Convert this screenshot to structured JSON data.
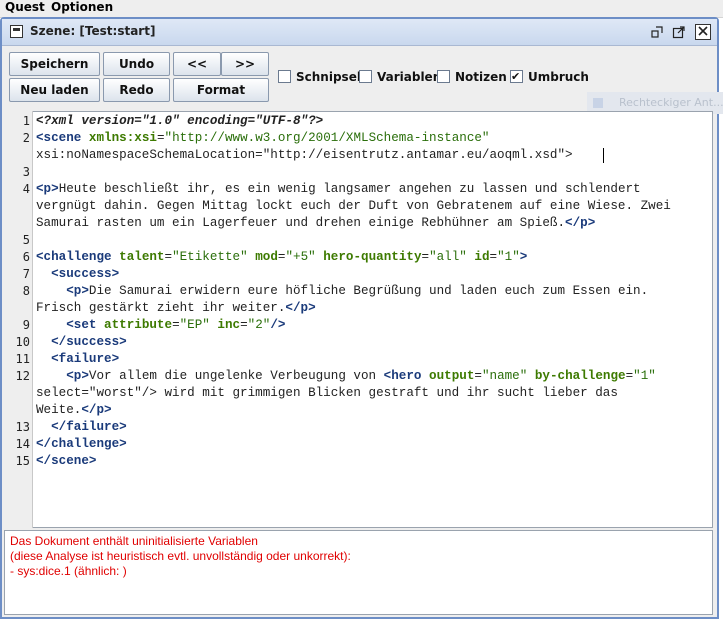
{
  "menubar": {
    "items": [
      "Quest",
      "Optionen"
    ]
  },
  "window": {
    "title": "Szene: [Test:start]",
    "controls": [
      "restore-icon",
      "maximize-icon",
      "close-icon"
    ]
  },
  "toolbar": {
    "save": "Speichern",
    "reload": "Neu laden",
    "undo": "Undo",
    "redo": "Redo",
    "prev": "<<",
    "next": ">>",
    "format": "Format",
    "checkboxes": [
      {
        "label": "Schnipsel",
        "checked": false
      },
      {
        "label": "Variablen",
        "checked": false
      },
      {
        "label": "Notizen",
        "checked": false
      },
      {
        "label": "Umbruch",
        "checked": true
      }
    ]
  },
  "faded_panel": {
    "text": "Rechteckiger Ant..."
  },
  "editor": {
    "line_numbers": [
      "1",
      "2",
      "",
      "3",
      "4",
      "",
      "",
      "5",
      "6",
      "7",
      "8",
      "",
      "9",
      "10",
      "11",
      "12",
      "",
      "",
      "13",
      "14",
      "15"
    ],
    "lines": [
      "<?xml version=\"1.0\" encoding=\"UTF-8\"?>",
      "<scene xmlns:xsi=\"http://www.w3.org/2001/XMLSchema-instance\"",
      "xsi:noNamespaceSchemaLocation=\"http://eisentrutz.antamar.eu/aoqml.xsd\">",
      "",
      "<p>Heute beschließt ihr, es ein wenig langsamer angehen zu lassen und schlendert",
      "vergnügt dahin. Gegen Mittag lockt euch der Duft von Gebratenem auf eine Wiese. Zwei",
      "Samurai rasten um ein Lagerfeuer und drehen einige Rebhühner am Spieß.</p>",
      "",
      "<challenge talent=\"Etikette\" mod=\"+5\" hero-quantity=\"all\" id=\"1\">",
      "  <success>",
      "    <p>Die Samurai erwidern eure höfliche Begrüßung und laden euch zum Essen ein.",
      "Frisch gestärkt zieht ihr weiter.</p>",
      "    <set attribute=\"EP\" inc=\"2\"/>",
      "  </success>",
      "  <failure>",
      "    <p>Vor allem die ungelenke Verbeugung von <hero output=\"name\" by-challenge=\"1\"",
      "select=\"worst\"/> wird mit grimmigen Blicken gestraft und ihr sucht lieber das",
      "Weite.</p>",
      "  </failure>",
      "</challenge>",
      "</scene>"
    ]
  },
  "messages": [
    "Das Dokument enthält uninitialisierte Variablen",
    "(diese Analyse ist heuristisch evtl. unvollständig oder unkorrekt):",
    "- sys:dice.1 (ähnlich: )"
  ],
  "colors": {
    "tag": "#1a3a7a",
    "attribute": "#3d7a00",
    "value": "#2a6e0a",
    "error": "#e00000",
    "frame_border": "#6d8ec6"
  }
}
